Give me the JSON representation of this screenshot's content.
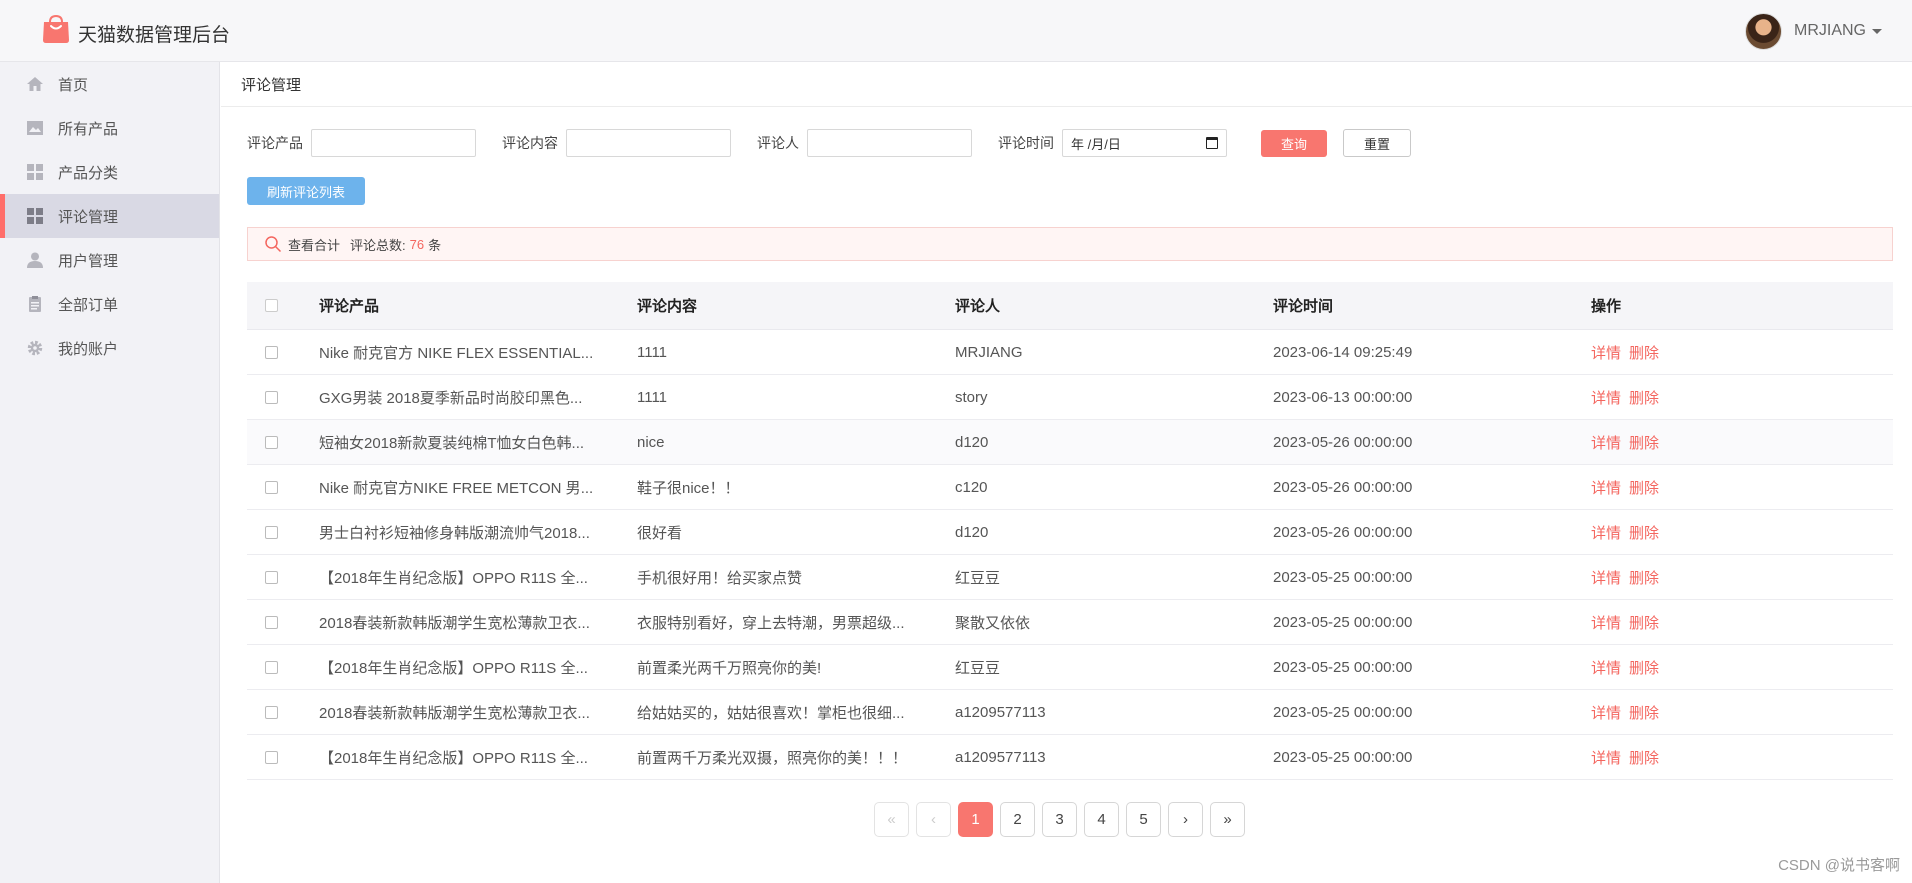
{
  "app": {
    "title": "天猫数据管理后台",
    "accent": "#f8766f"
  },
  "user": {
    "name": "MRJIANG"
  },
  "sidebar": {
    "items": [
      {
        "label": "首页",
        "icon": "home-icon"
      },
      {
        "label": "所有产品",
        "icon": "image-icon"
      },
      {
        "label": "产品分类",
        "icon": "category-icon"
      },
      {
        "label": "评论管理",
        "icon": "dashboard-icon",
        "active": true
      },
      {
        "label": "用户管理",
        "icon": "user-icon"
      },
      {
        "label": "全部订单",
        "icon": "clipboard-icon"
      },
      {
        "label": "我的账户",
        "icon": "gear-icon"
      }
    ]
  },
  "breadcrumb": "评论管理",
  "filters": {
    "product_label": "评论产品",
    "content_label": "评论内容",
    "reviewer_label": "评论人",
    "time_label": "评论时间",
    "date_placeholder": "年 /月/日",
    "query_label": "查询",
    "reset_label": "重置"
  },
  "refresh_label": "刷新评论列表",
  "summary": {
    "label": "查看合计",
    "total_label": "评论总数:",
    "total": "76",
    "unit": "条"
  },
  "table": {
    "headers": [
      "评论产品",
      "评论内容",
      "评论人",
      "评论时间",
      "操作"
    ],
    "ops": {
      "detail": "详情",
      "delete": "删除"
    },
    "rows": [
      {
        "product": "Nike 耐克官方 NIKE FLEX ESSENTIAL...",
        "content": "1111",
        "reviewer": "MRJIANG",
        "time": "2023-06-14 09:25:49"
      },
      {
        "product": "GXG男装 2018夏季新品时尚胶印黑色...",
        "content": "1111",
        "reviewer": "story",
        "time": "2023-06-13 00:00:00"
      },
      {
        "product": "短袖女2018新款夏装纯棉T恤女白色韩...",
        "content": "nice",
        "reviewer": "d120",
        "time": "2023-05-26 00:00:00"
      },
      {
        "product": "Nike 耐克官方NIKE FREE METCON 男...",
        "content": "鞋子很nice！！",
        "reviewer": "c120",
        "time": "2023-05-26 00:00:00"
      },
      {
        "product": "男士白衬衫短袖修身韩版潮流帅气2018...",
        "content": "很好看",
        "reviewer": "d120",
        "time": "2023-05-26 00:00:00"
      },
      {
        "product": "【2018年生肖纪念版】OPPO R11S 全...",
        "content": "手机很好用！给买家点赞",
        "reviewer": "红豆豆",
        "time": "2023-05-25 00:00:00"
      },
      {
        "product": "2018春装新款韩版潮学生宽松薄款卫衣...",
        "content": "衣服特别看好，穿上去特潮，男票超级...",
        "reviewer": "聚散又依依",
        "time": "2023-05-25 00:00:00"
      },
      {
        "product": "【2018年生肖纪念版】OPPO R11S 全...",
        "content": "前置柔光两千万照亮你的美!",
        "reviewer": "红豆豆",
        "time": "2023-05-25 00:00:00"
      },
      {
        "product": "2018春装新款韩版潮学生宽松薄款卫衣...",
        "content": "给姑姑买的，姑姑很喜欢！掌柜也很细...",
        "reviewer": "a1209577113",
        "time": "2023-05-25 00:00:00"
      },
      {
        "product": "【2018年生肖纪念版】OPPO R11S 全...",
        "content": "前置两千万柔光双摄，照亮你的美！！！",
        "reviewer": "a1209577113",
        "time": "2023-05-25 00:00:00"
      }
    ]
  },
  "pagination": {
    "first": "«",
    "prev": "‹",
    "pages": [
      "1",
      "2",
      "3",
      "4",
      "5"
    ],
    "next": "›",
    "last": "»",
    "current": "1"
  },
  "watermark": "CSDN @说书客啊"
}
